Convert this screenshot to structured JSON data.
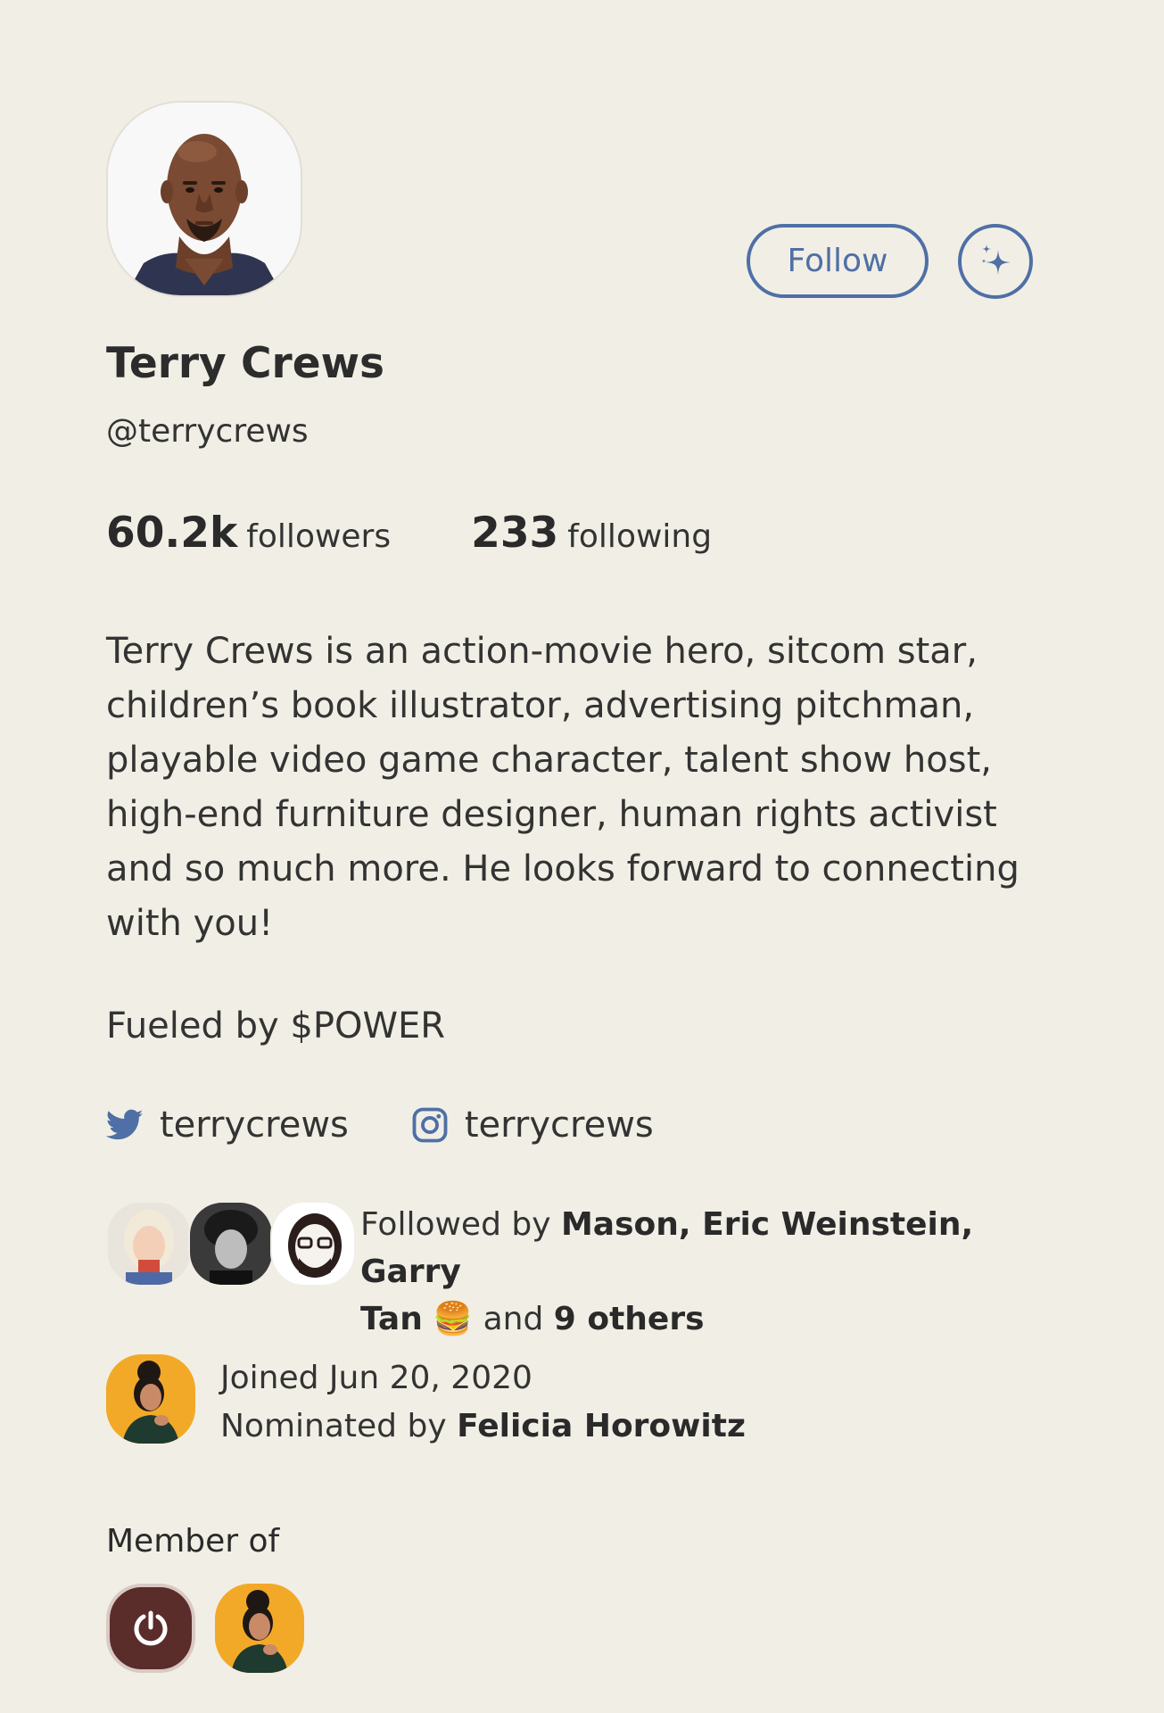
{
  "profile": {
    "name": "Terry Crews",
    "handle": "@terrycrews",
    "avatar_icon": "person-photo"
  },
  "actions": {
    "follow_label": "Follow",
    "sparkle_icon": "sparkle-icon",
    "accent_color": "#4f6fa6"
  },
  "stats": {
    "followers_count": "60.2k",
    "followers_label": "followers",
    "following_count": "233",
    "following_label": "following"
  },
  "bio": {
    "lines": [
      "Terry Crews is an action-movie hero, sitcom star,",
      "children’s book illustrator, advertising pitchman,",
      "playable video game character, talent show host,",
      "high-end furniture designer, human rights activist",
      "and so much more. He looks forward to connecting",
      "with you!"
    ],
    "fueled": "Fueled by $POWER"
  },
  "socials": {
    "twitter": {
      "icon": "twitter-icon",
      "username": "terrycrews"
    },
    "instagram": {
      "icon": "instagram-icon",
      "username": "terrycrews"
    }
  },
  "followed_by": {
    "prefix": "Followed by",
    "names": "Mason, Eric Weinstein, Garry",
    "names_cont": "Tan",
    "emoji": "🍔",
    "and_text": "and",
    "others": "9 others"
  },
  "joined": {
    "date_text": "Joined Jun 20, 2020",
    "nominated_prefix": "Nominated by",
    "nominator": "Felicia Horowitz"
  },
  "member_of": {
    "label": "Member of",
    "clubs": [
      {
        "icon": "power-icon",
        "color": "#5a2c2a"
      },
      {
        "icon": "person-photo",
        "color": "#f3a928"
      }
    ]
  }
}
